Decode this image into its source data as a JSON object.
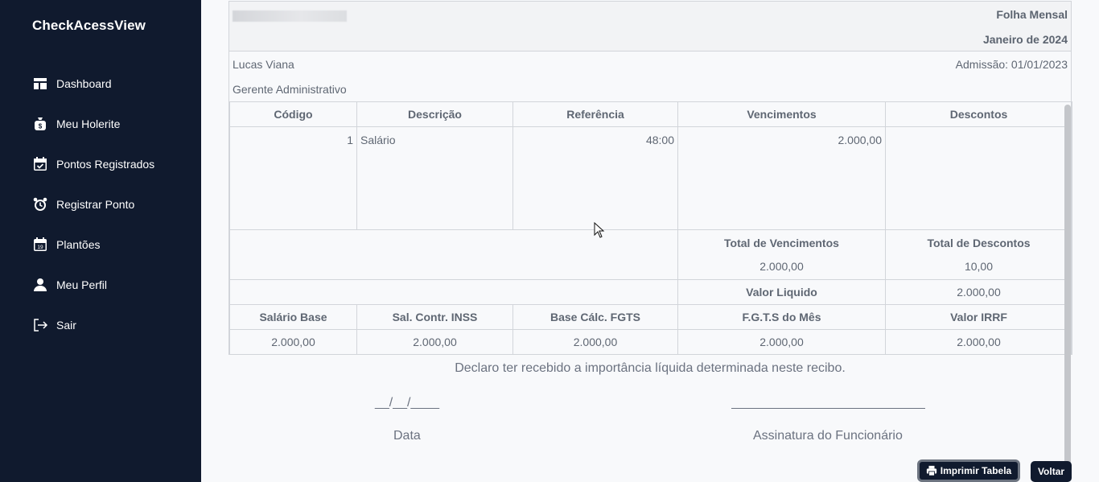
{
  "app": {
    "brand": "CheckAcessView"
  },
  "sidebar": {
    "items": [
      {
        "label": "Dashboard",
        "icon": "dashboard-icon"
      },
      {
        "label": "Meu Holerite",
        "icon": "money-bag-icon"
      },
      {
        "label": "Pontos Registrados",
        "icon": "calendar-check-icon"
      },
      {
        "label": "Registrar Ponto",
        "icon": "alarm-clock-icon"
      },
      {
        "label": "Plantões",
        "icon": "calendar-day-icon"
      },
      {
        "label": "Meu Perfil",
        "icon": "user-icon"
      },
      {
        "label": "Sair",
        "icon": "logout-icon"
      }
    ]
  },
  "payslip": {
    "title": "Folha Mensal",
    "period": "Janeiro de 2024",
    "employee_name": "Lucas Viana",
    "admission": "Admissão: 01/01/2023",
    "role": "Gerente Administrativo",
    "headers": {
      "codigo": "Código",
      "descricao": "Descrição",
      "referencia": "Referência",
      "vencimentos": "Vencimentos",
      "descontos": "Descontos"
    },
    "items": [
      {
        "codigo": "1",
        "descricao": "Salário",
        "referencia": "48:00",
        "vencimentos": "2.000,00",
        "descontos": ""
      }
    ],
    "totals": {
      "vencimentos_label": "Total de Vencimentos",
      "vencimentos_value": "2.000,00",
      "descontos_label": "Total de Descontos",
      "descontos_value": "10,00",
      "liquido_label": "Valor Liquido",
      "liquido_value": "2.000,00"
    },
    "bases": {
      "headers": [
        "Salário Base",
        "Sal. Contr. INSS",
        "Base Cálc. FGTS",
        "F.G.T.S do Mês",
        "Valor IRRF"
      ],
      "values": [
        "2.000,00",
        "2.000,00",
        "2.000,00",
        "2.000,00",
        "2.000,00"
      ]
    },
    "declaration": "Declaro ter recebido a importância líquida determinada neste recibo.",
    "date_placeholder": "__/__/____",
    "date_label": "Data",
    "signature_label": "Assinatura do Funcionário"
  },
  "actions": {
    "print_label": "Imprimir Tabela",
    "back_label": "Voltar"
  }
}
